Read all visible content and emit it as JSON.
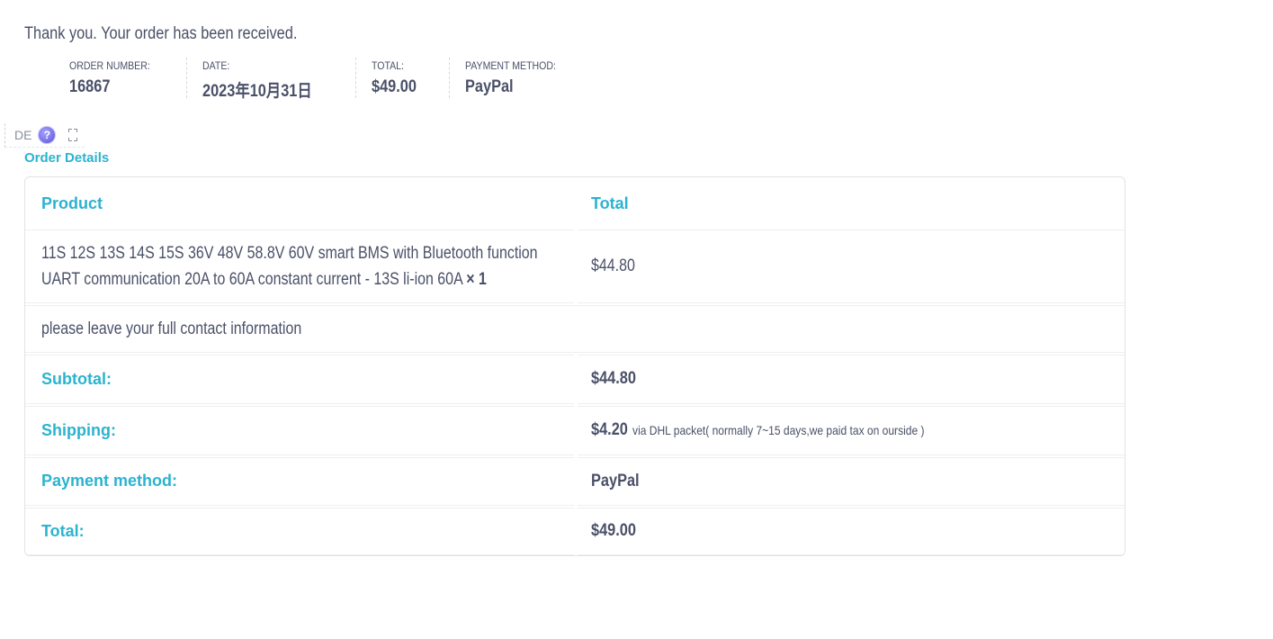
{
  "thank_you": "Thank you. Your order has been received.",
  "overview": [
    {
      "label": "ORDER NUMBER:",
      "value": "16867"
    },
    {
      "label": "DATE:",
      "value": "2023年10月31日"
    },
    {
      "label": "TOTAL:",
      "value": "$49.00"
    },
    {
      "label": "PAYMENT METHOD:",
      "value": "PayPal"
    }
  ],
  "lang_widget": {
    "code": "DE",
    "help_icon": "help-circle-icon",
    "expand_icon": "expand-icon"
  },
  "details_heading": "Order Details",
  "table": {
    "header": {
      "product": "Product",
      "total": "Total"
    },
    "item": {
      "name_line1": "11S 12S 13S 14S 15S 36V 48V 58.8V 60V smart BMS with Bluetooth function",
      "name_line2": "UART communication 20A to 60A constant current - 13S li-ion 60A",
      "quantity": "× 1",
      "total": "$44.80"
    },
    "note": "please leave your full contact information",
    "subtotal": {
      "label": "Subtotal:",
      "value": "$44.80"
    },
    "shipping": {
      "label": "Shipping:",
      "value": "$4.20",
      "note": "via DHL packet( normally 7~15 days,we paid tax on ourside )"
    },
    "payment": {
      "label": "Payment method:",
      "value": "PayPal"
    },
    "total": {
      "label": "Total:",
      "value": "$49.00"
    }
  },
  "colors": {
    "accent": "#2bb3cf",
    "text": "#4a5068",
    "border": "#e1e3e8"
  }
}
